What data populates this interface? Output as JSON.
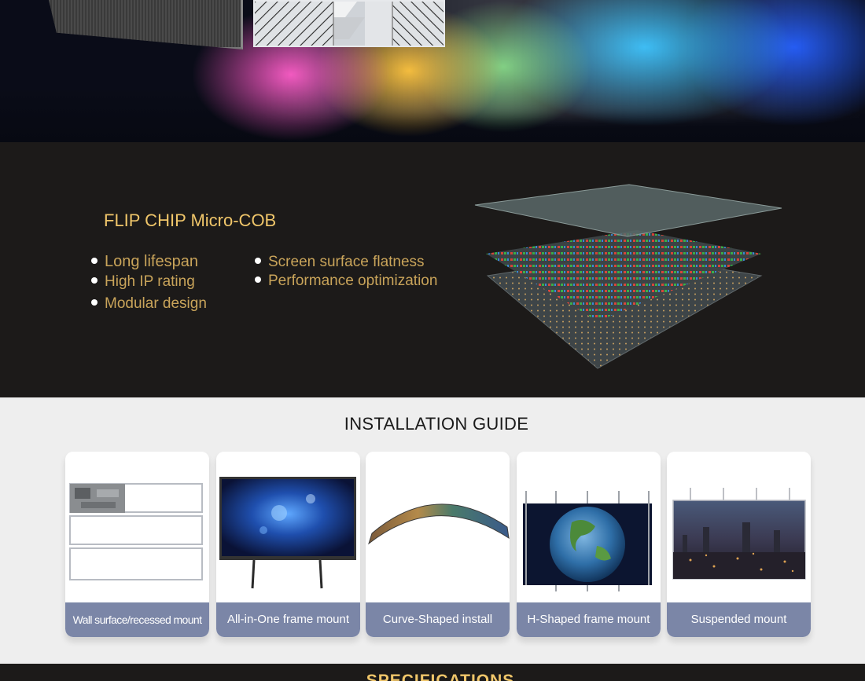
{
  "feature": {
    "title": "FLIP CHIP Micro-COB",
    "bullets_left": [
      "Long lifespan",
      "High IP rating",
      "Modular design"
    ],
    "bullets_right": [
      "Screen surface flatness",
      "Performance optimization"
    ]
  },
  "installation": {
    "title": "INSTALLATION GUIDE",
    "cards": [
      {
        "label": "Wall surface/recessed mount"
      },
      {
        "label": "All-in-One frame mount"
      },
      {
        "label": "Curve-Shaped install"
      },
      {
        "label": "H-Shaped frame mount"
      },
      {
        "label": "Suspended mount"
      }
    ]
  },
  "specifications": {
    "title": "SPECIFICATIONS"
  },
  "colors": {
    "gold": "#f0c66a",
    "bullet_text": "#c9a45a",
    "dark_bg": "#1c1a19",
    "card_label_bg": "#7b86a7"
  }
}
